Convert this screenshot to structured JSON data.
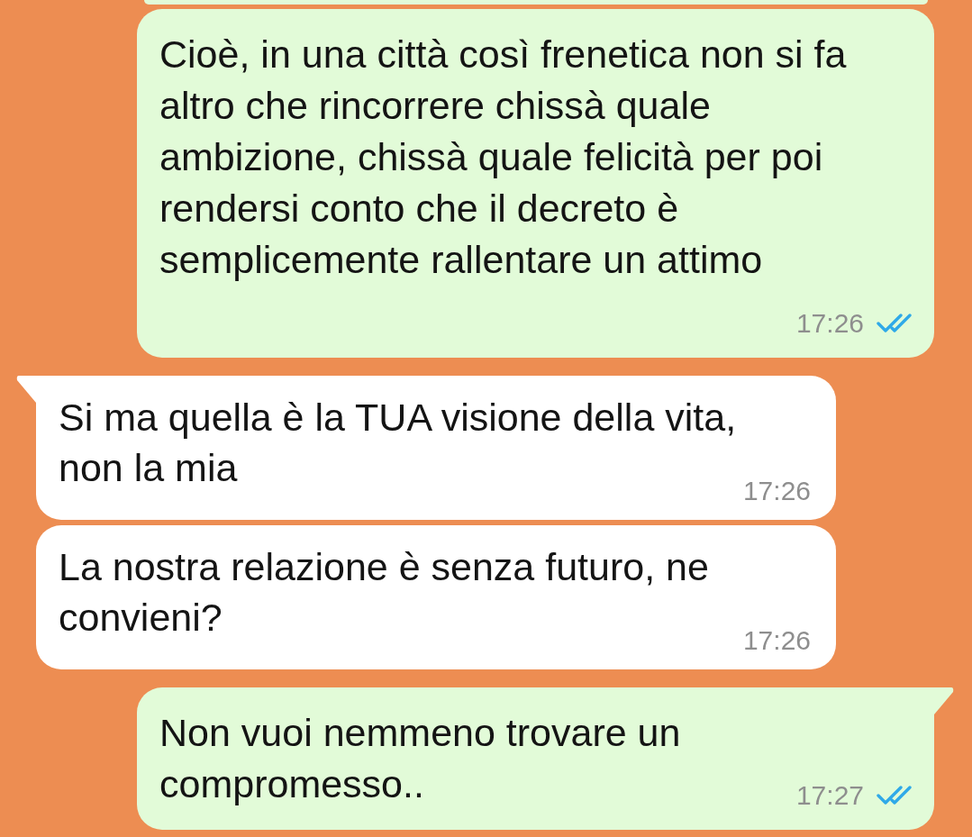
{
  "partial_bubble_above": true,
  "messages": [
    {
      "kind": "outgoing",
      "tail": false,
      "text": "Cioè, in una città così frenetica non si fa altro che rincorrere chissà quale ambizione, chissà quale felicità per poi rendersi conto che il decreto è semplicemente rallentare un attimo",
      "time": "17:26",
      "read": true
    },
    {
      "kind": "incoming",
      "tail": true,
      "text": "Si ma quella è la TUA visione della vita, non la mia",
      "time": "17:26"
    },
    {
      "kind": "incoming",
      "tail": false,
      "text": "La nostra relazione è senza futuro, ne convieni?",
      "time": "17:26"
    },
    {
      "kind": "outgoing",
      "tail": true,
      "text": "Non vuoi nemmeno trovare un compromesso..",
      "time": "17:27",
      "read": true
    }
  ]
}
